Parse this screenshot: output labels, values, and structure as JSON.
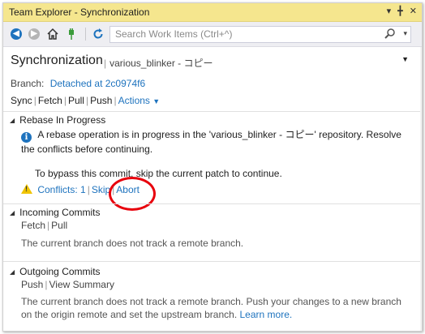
{
  "window": {
    "title": "Team Explorer - Synchronization"
  },
  "toolbar": {
    "search_placeholder": "Search Work Items (Ctrl+^)",
    "icons": [
      "back-icon",
      "forward-icon",
      "home-icon",
      "connect-icon",
      "refresh-icon",
      "search-icon"
    ]
  },
  "header": {
    "title": "Synchronization",
    "subtitle": "various_blinker - コピー"
  },
  "branch": {
    "label": "Branch:",
    "value": "Detached at 2c0974f6"
  },
  "actions": {
    "sync": "Sync",
    "fetch": "Fetch",
    "pull": "Pull",
    "push": "Push",
    "actions": "Actions"
  },
  "rebase": {
    "heading": "Rebase In Progress",
    "message": "A rebase operation is in progress in the 'various_blinker - コピー' repository. Resolve the conflicts before continuing.",
    "bypass": "To bypass this commit, skip the current patch to continue.",
    "conflicts": "Conflicts: 1",
    "skip": "Skip",
    "abort": "Abort"
  },
  "incoming": {
    "heading": "Incoming Commits",
    "fetch": "Fetch",
    "pull": "Pull",
    "note": "The current branch does not track a remote branch."
  },
  "outgoing": {
    "heading": "Outgoing Commits",
    "push": "Push",
    "view_summary": "View Summary",
    "note": "The current branch does not track a remote branch. Push your changes to a new branch on the origin remote and set the upstream branch.",
    "learn_more": "Learn more."
  },
  "colors": {
    "titlebar": "#f5e68e",
    "link": "#1e73be",
    "annotation": "#e8000c"
  }
}
